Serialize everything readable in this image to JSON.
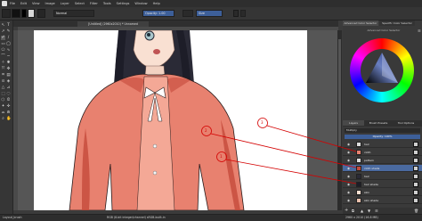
{
  "menubar": {
    "items": [
      "File",
      "Edit",
      "View",
      "Image",
      "Layer",
      "Select",
      "Filter",
      "Tools",
      "Settings",
      "Window",
      "Help"
    ]
  },
  "tool_options": {
    "blend_mode": "Normal",
    "opacity_label": "Opacity: 1.00",
    "size_label": "Size",
    "size_value": "5.00 px"
  },
  "document": {
    "tab_title": "[Untitled] (2960x2010) * Unnamed"
  },
  "right_panel": {
    "tabs": [
      "Advanced Color Selector",
      "Specific Color Selector"
    ],
    "color_selector_title": "Advanced Color Selector",
    "bottom_tabs": [
      "Layers",
      "Brush Presets",
      "Tool Options"
    ],
    "blend_mode": "Multiply",
    "opacity_label": "Opacity: 100%",
    "layers": [
      {
        "name": "hair"
      },
      {
        "name": "cloth"
      },
      {
        "name": "pattern"
      },
      {
        "name": "cloth shade"
      },
      {
        "name": "hair"
      },
      {
        "name": "hair shade"
      },
      {
        "name": "skin"
      },
      {
        "name": "skin shade"
      }
    ]
  },
  "annotations": {
    "callouts": [
      "3",
      "2",
      "1"
    ]
  },
  "statusbar": {
    "left": "Layout_brush",
    "middle": "RGB (8-bit integer/channel) sRGB-built-in",
    "right": "2960 x 2010 (16.8 MB)"
  },
  "colors": {
    "cardigan": "#e8816f",
    "cardigan_dark": "#c44a3b",
    "skin": "#f9e0d2",
    "hair": "#2a2a36",
    "annotation": "#d40000",
    "layer_selected": "#4a6aa0"
  }
}
